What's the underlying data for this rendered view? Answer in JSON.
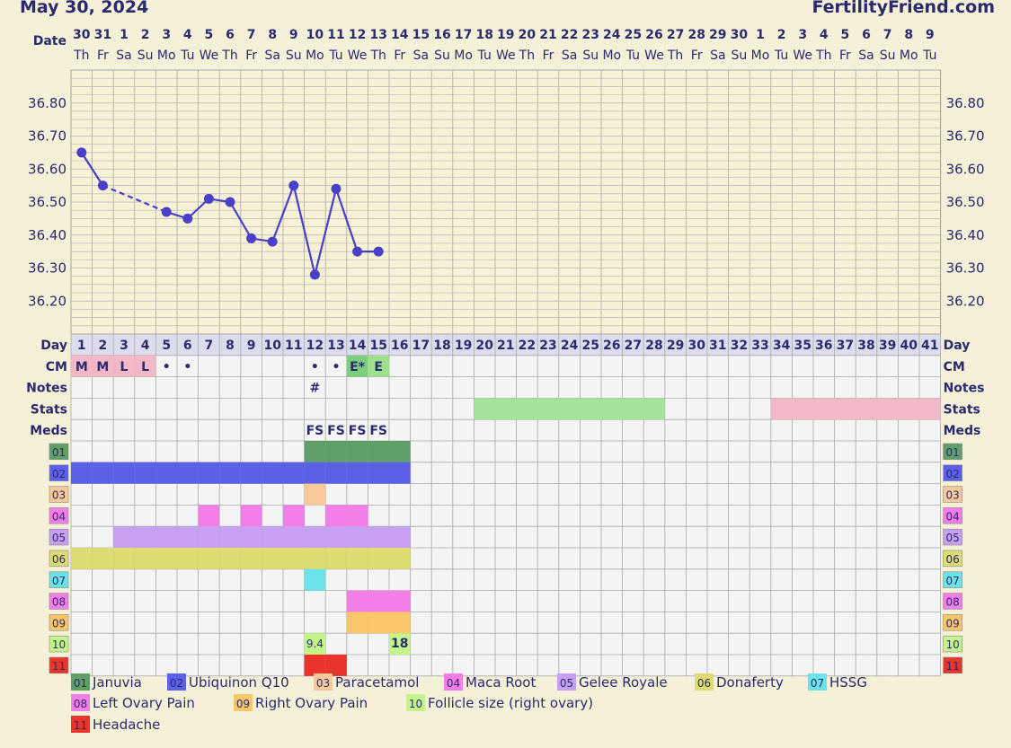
{
  "header": {
    "date_title": "May 30, 2024",
    "site": "FertilityFriend.com"
  },
  "row_labels": {
    "date": "Date",
    "day": "Day",
    "cm": "CM",
    "notes": "Notes",
    "stats": "Stats",
    "meds": "Meds"
  },
  "chart_data": {
    "type": "line",
    "dates": [
      "30",
      "31",
      "1",
      "2",
      "3",
      "4",
      "5",
      "6",
      "7",
      "8",
      "9",
      "10",
      "11",
      "12",
      "13",
      "14",
      "15",
      "16",
      "17",
      "18",
      "19",
      "20",
      "21",
      "22",
      "23",
      "24",
      "25",
      "26",
      "27",
      "28",
      "29",
      "30",
      "1",
      "2",
      "3",
      "4",
      "5",
      "6",
      "7",
      "8",
      "9"
    ],
    "weekdays": [
      "Th",
      "Fr",
      "Sa",
      "Su",
      "Mo",
      "Tu",
      "We",
      "Th",
      "Fr",
      "Sa",
      "Su",
      "Mo",
      "Tu",
      "We",
      "Th",
      "Fr",
      "Sa",
      "Su",
      "Mo",
      "Tu",
      "We",
      "Th",
      "Fr",
      "Sa",
      "Su",
      "Mo",
      "Tu",
      "We",
      "Th",
      "Fr",
      "Sa",
      "Su",
      "Mo",
      "Tu",
      "We",
      "Th",
      "Fr",
      "Sa",
      "Su",
      "Mo",
      "Tu"
    ],
    "cycle_days": [
      1,
      2,
      3,
      4,
      5,
      6,
      7,
      8,
      9,
      10,
      11,
      12,
      13,
      14,
      15,
      16,
      17,
      18,
      19,
      20,
      21,
      22,
      23,
      24,
      25,
      26,
      27,
      28,
      29,
      30,
      31,
      32,
      33,
      34,
      35,
      36,
      37,
      38,
      39,
      40,
      41
    ],
    "temperatures": [
      {
        "day": 1,
        "temp": 36.65
      },
      {
        "day": 2,
        "temp": 36.55
      },
      {
        "day": 5,
        "temp": 36.47
      },
      {
        "day": 6,
        "temp": 36.45
      },
      {
        "day": 7,
        "temp": 36.51
      },
      {
        "day": 8,
        "temp": 36.5
      },
      {
        "day": 9,
        "temp": 36.39
      },
      {
        "day": 10,
        "temp": 36.38
      },
      {
        "day": 11,
        "temp": 36.55
      },
      {
        "day": 12,
        "temp": 36.28
      },
      {
        "day": 13,
        "temp": 36.54
      },
      {
        "day": 14,
        "temp": 36.35
      },
      {
        "day": 15,
        "temp": 36.35
      }
    ],
    "dashed_segment": [
      2,
      5
    ],
    "y_ticks": [
      "36.80",
      "36.70",
      "36.60",
      "36.50",
      "36.40",
      "36.30",
      "36.20"
    ],
    "ylim": [
      36.1,
      36.9
    ],
    "line_color": "#4a3fc8",
    "cm": [
      {
        "day": 1,
        "text": "M",
        "color": "#f2b8c8"
      },
      {
        "day": 2,
        "text": "M",
        "color": "#f2b8c8"
      },
      {
        "day": 3,
        "text": "L",
        "color": "#f2b8c8"
      },
      {
        "day": 4,
        "text": "L",
        "color": "#f2b8c8"
      },
      {
        "day": 5,
        "text": "•",
        "color": ""
      },
      {
        "day": 6,
        "text": "•",
        "color": ""
      },
      {
        "day": 12,
        "text": "•",
        "color": ""
      },
      {
        "day": 13,
        "text": "•",
        "color": ""
      },
      {
        "day": 14,
        "text": "E*",
        "color": "#7ccf7c"
      },
      {
        "day": 15,
        "text": "E",
        "color": "#9fe08f"
      }
    ],
    "notes": [
      {
        "day": 12,
        "text": "#"
      }
    ],
    "stats": [
      {
        "from": 20,
        "to": 28,
        "color": "#a6e39a"
      },
      {
        "from": 34,
        "to": 41,
        "color": "#f2b8c8"
      }
    ],
    "meds_row": [
      {
        "day": 12,
        "text": "FS"
      },
      {
        "day": 13,
        "text": "FS"
      },
      {
        "day": 14,
        "text": "FS"
      },
      {
        "day": 15,
        "text": "FS"
      }
    ],
    "med_rows": [
      {
        "code": "01",
        "name": "Januvia",
        "color": "#5f9e67",
        "days": [
          12,
          13,
          14,
          15,
          16
        ]
      },
      {
        "code": "02",
        "name": "Ubiquinon Q10",
        "color": "#5a60e8",
        "days": [
          1,
          2,
          3,
          4,
          5,
          6,
          7,
          8,
          9,
          10,
          11,
          12,
          13,
          14,
          15,
          16
        ]
      },
      {
        "code": "03",
        "name": "Paracetamol",
        "color": "#f7c89a",
        "days": [
          12
        ]
      },
      {
        "code": "04",
        "name": "Maca Root",
        "color": "#f47ee8",
        "days": [
          7,
          9,
          11,
          13,
          14
        ]
      },
      {
        "code": "05",
        "name": "Gelee Royale",
        "color": "#c7a0f2",
        "days": [
          3,
          4,
          5,
          6,
          7,
          8,
          9,
          10,
          11,
          12,
          13,
          14,
          15,
          16
        ]
      },
      {
        "code": "06",
        "name": "Donaferty",
        "color": "#dcdc72",
        "days": [
          1,
          2,
          3,
          4,
          5,
          6,
          7,
          8,
          9,
          10,
          11,
          12,
          13,
          14,
          15,
          16
        ]
      },
      {
        "code": "07",
        "name": "HSSG",
        "color": "#6ce3e8",
        "days": [
          12
        ]
      },
      {
        "code": "08",
        "name": "Left Ovary Pain",
        "color": "#f47ee8",
        "days": [
          14,
          15,
          16
        ]
      },
      {
        "code": "09",
        "name": "Right Ovary Pain",
        "color": "#f9c66a",
        "days": [
          14,
          15,
          16
        ]
      },
      {
        "code": "10",
        "name": "Follicle size (right ovary)",
        "color": "#c4f58a",
        "days": [
          12,
          16
        ],
        "labels": {
          "12": "9.4",
          "16": "18"
        }
      },
      {
        "code": "11",
        "name": "Headache",
        "color": "#e8342a",
        "days": [
          12,
          13
        ]
      }
    ]
  }
}
